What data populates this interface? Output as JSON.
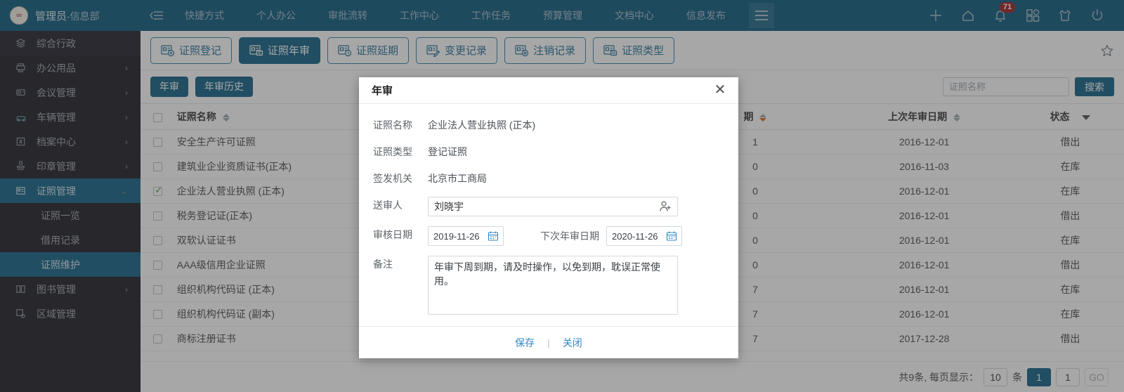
{
  "topbar": {
    "brand_user": "管理员",
    "brand_dept": "-信息部",
    "logo_text": "∞",
    "nav": [
      {
        "label": "快捷方式"
      },
      {
        "label": "个人办公"
      },
      {
        "label": "审批流转"
      },
      {
        "label": "工作中心"
      },
      {
        "label": "工作任务"
      },
      {
        "label": "预算管理"
      },
      {
        "label": "文档中心"
      },
      {
        "label": "信息发布"
      }
    ],
    "notification_count": "71",
    "icons": {
      "collapse": "collapse-icon",
      "menu": "hamburger-icon",
      "add": "plus-icon",
      "home": "home-icon",
      "bell": "bell-icon",
      "apps": "apps-grid-icon",
      "theme": "tshirt-theme-icon",
      "power": "power-icon"
    }
  },
  "sidebar": {
    "items": [
      {
        "label": "综合行政",
        "icon": "layers-icon",
        "expandable": false,
        "active": false
      },
      {
        "label": "办公用品",
        "icon": "printer-icon",
        "expandable": true,
        "active": false
      },
      {
        "label": "会议管理",
        "icon": "projector-icon",
        "expandable": true,
        "active": false
      },
      {
        "label": "车辆管理",
        "icon": "car-icon",
        "expandable": true,
        "active": false
      },
      {
        "label": "档案中心",
        "icon": "archive-icon",
        "expandable": true,
        "active": false
      },
      {
        "label": "印章管理",
        "icon": "stamp-icon",
        "expandable": true,
        "active": false
      },
      {
        "label": "证照管理",
        "icon": "certificate-icon",
        "expandable": true,
        "active": true
      }
    ],
    "sub_items": [
      {
        "label": "证照一览",
        "active": false
      },
      {
        "label": "借用记录",
        "active": false
      },
      {
        "label": "证照维护",
        "active": true
      }
    ],
    "items_after": [
      {
        "label": "图书管理",
        "icon": "book-icon",
        "expandable": true,
        "active": false
      },
      {
        "label": "区域管理",
        "icon": "region-icon",
        "expandable": false,
        "active": false
      }
    ]
  },
  "toolbar": {
    "buttons": [
      {
        "label": "证照登记",
        "icon": "cert-add-icon",
        "active": false
      },
      {
        "label": "证照年审",
        "icon": "cert-review-icon",
        "active": true
      },
      {
        "label": "证照延期",
        "icon": "cert-extend-icon",
        "active": false
      },
      {
        "label": "变更记录",
        "icon": "cert-change-icon",
        "active": false
      },
      {
        "label": "注销记录",
        "icon": "cert-cancel-icon",
        "active": false
      },
      {
        "label": "证照类型",
        "icon": "cert-type-icon",
        "active": false
      }
    ],
    "favorite_icon": "star-icon"
  },
  "subbar": {
    "tabs": [
      {
        "label": "年审"
      },
      {
        "label": "年审历史"
      }
    ]
  },
  "search": {
    "placeholder": "证照名称",
    "value": "",
    "button_label": "搜索"
  },
  "table": {
    "columns": [
      {
        "key": "check",
        "label": "",
        "sortable": false
      },
      {
        "key": "name",
        "label": "证照名称",
        "sortable": true
      },
      {
        "key": "type",
        "label": "",
        "sortable": false
      },
      {
        "key": "org",
        "label": "",
        "sortable": false
      },
      {
        "key": "date",
        "label": "期",
        "sortable": true,
        "sort": "desc"
      },
      {
        "key": "last_review",
        "label": "上次年审日期",
        "sortable": true
      },
      {
        "key": "status",
        "label": "状态",
        "filter": true
      }
    ],
    "rows": [
      {
        "checked": false,
        "name": "安全生产许可证照",
        "date": "1",
        "last_review": "2016-12-01",
        "status": "借出"
      },
      {
        "checked": false,
        "name": "建筑业企业资质证书(正本)",
        "date": "0",
        "last_review": "2016-11-03",
        "status": "在库"
      },
      {
        "checked": true,
        "name": "企业法人营业执照 (正本)",
        "date": "0",
        "last_review": "2016-12-01",
        "status": "在库"
      },
      {
        "checked": false,
        "name": "税务登记证(正本)",
        "date": "0",
        "last_review": "2016-12-01",
        "status": "借出"
      },
      {
        "checked": false,
        "name": "双软认证证书",
        "date": "0",
        "last_review": "2016-12-01",
        "status": "在库"
      },
      {
        "checked": false,
        "name": "AAA级信用企业证照",
        "date": "0",
        "last_review": "2016-12-01",
        "status": "借出"
      },
      {
        "checked": false,
        "name": "组织机构代码证 (正本)",
        "date": "7",
        "last_review": "2016-12-01",
        "status": "在库"
      },
      {
        "checked": false,
        "name": "组织机构代码证 (副本)",
        "date": "7",
        "last_review": "2016-12-01",
        "status": "在库"
      },
      {
        "checked": false,
        "name": "商标注册证书",
        "date": "7",
        "last_review": "2017-12-28",
        "status": "借出"
      }
    ]
  },
  "pager": {
    "summary": "共9条, 每页显示：",
    "page_size": "10",
    "unit": "条",
    "current_page": "1",
    "jump_value": "1",
    "go_label": "GO"
  },
  "modal": {
    "title": "年审",
    "close_icon": "close-icon",
    "fields": {
      "cert_name_label": "证照名称",
      "cert_name_value": "企业法人营业执照 (正本)",
      "cert_type_label": "证照类型",
      "cert_type_value": "登记证照",
      "issuer_label": "签发机关",
      "issuer_value": "北京市工商局",
      "submitter_label": "送审人",
      "submitter_value": "刘晓宇",
      "submitter_picker_icon": "user-add-icon",
      "review_date_label": "审核日期",
      "review_date_value": "2019-11-26",
      "next_date_label": "下次年审日期",
      "next_date_value": "2020-11-26",
      "calendar_icon": "calendar-icon",
      "remark_label": "备注",
      "remark_value": "年审下周到期，请及时操作，以免到期，耽误正常使用。"
    },
    "save_label": "保存",
    "close_label": "关闭"
  },
  "colors": {
    "brand_blue": "#07577a",
    "accent_blue": "#0b5e82",
    "link_blue": "#2f86c5",
    "sidebar_bg": "#16161f",
    "badge_red": "#9c1818",
    "sort_active": "#d2691e"
  }
}
